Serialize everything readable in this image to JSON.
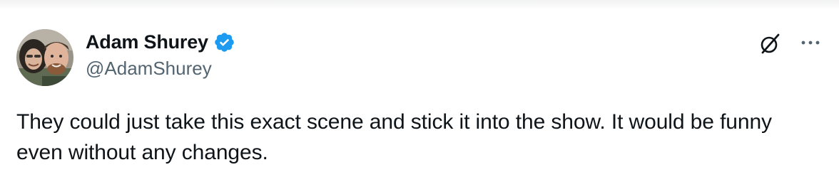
{
  "author": {
    "display_name": "Adam Shurey",
    "handle": "@AdamShurey",
    "verified": true,
    "avatar": "profile-photo-two-people"
  },
  "actions": {
    "grok_icon": "grok-slash-circle-icon",
    "more_icon": "more-ellipsis-icon"
  },
  "tweet": {
    "text": "They could just take this exact scene and stick it into the show. It would be funny even without any changes."
  },
  "colors": {
    "text_primary": "#0f1419",
    "text_secondary": "#536471",
    "verified_blue": "#1d9bf0"
  }
}
